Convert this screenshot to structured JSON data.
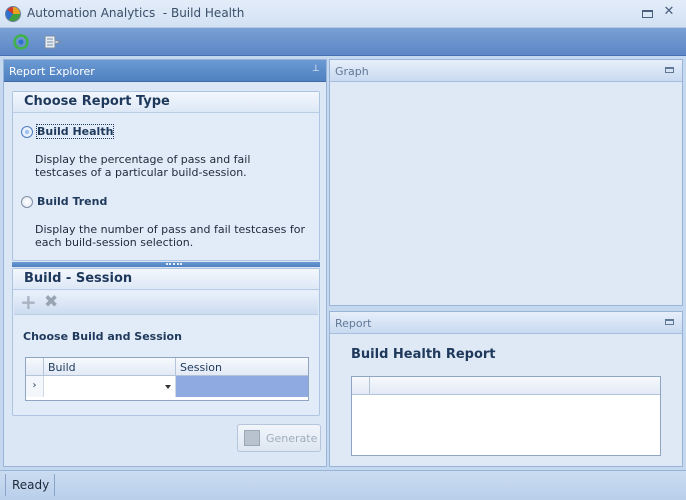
{
  "window": {
    "title": "Automation Analytics  - Build Health",
    "app_icon": "pie-chart-icon"
  },
  "toolbar": {
    "buttons": [
      {
        "icon": "refresh-icon"
      },
      {
        "icon": "export-icon"
      }
    ]
  },
  "report_explorer": {
    "title": "Report Explorer",
    "choose_report_type": {
      "title": "Choose Report Type",
      "options": [
        {
          "label": "Build Health",
          "description": "Display the percentage of pass and fail testcases of a particular build-session.",
          "selected": true
        },
        {
          "label": "Build Trend",
          "description": "Display the number of pass and fail testcases for each build-session selection.",
          "selected": false
        }
      ]
    },
    "build_session": {
      "title": "Build - Session",
      "choose_label": "Choose Build and Session",
      "columns": [
        "Build",
        "Session"
      ],
      "rows": [
        {
          "build": "",
          "session": ""
        }
      ]
    },
    "generate_label": "Generate"
  },
  "graph": {
    "title": "Graph"
  },
  "report": {
    "title": "Report",
    "heading": "Build Health Report"
  },
  "status": {
    "text": "Ready"
  },
  "colors": {
    "toolbar": "#5b87c6",
    "panel_bg": "#dfe9f6",
    "selected_cell": "#8faae0",
    "text": "#1e395b"
  }
}
